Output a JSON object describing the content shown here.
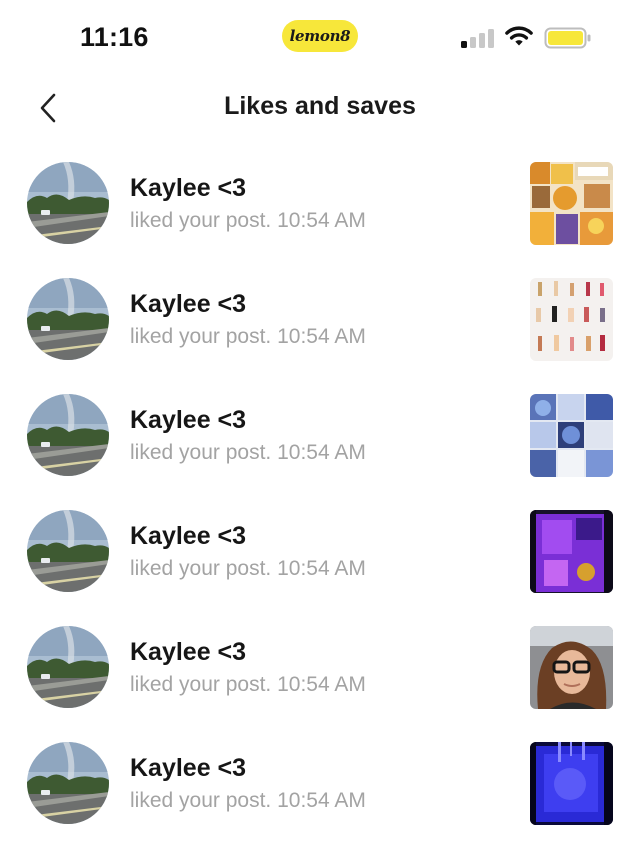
{
  "status_bar": {
    "time": "11:16",
    "app_badge": "lemon8",
    "icons": [
      "cellular-signal-icon",
      "wifi-icon",
      "battery-icon"
    ]
  },
  "header": {
    "back_icon": "chevron-left-icon",
    "title": "Likes and saves"
  },
  "notifications": [
    {
      "user": "Kaylee <3",
      "action": "liked your post.",
      "time": "10:54 AM",
      "thumbnail": "collage-cartoon-stickers"
    },
    {
      "user": "Kaylee <3",
      "action": "liked your post.",
      "time": "10:54 AM",
      "thumbnail": "makeup-products-grid"
    },
    {
      "user": "Kaylee <3",
      "action": "liked your post.",
      "time": "10:54 AM",
      "thumbnail": "stitch-collage"
    },
    {
      "user": "Kaylee <3",
      "action": "liked your post.",
      "time": "10:54 AM",
      "thumbnail": "purple-neon-screen"
    },
    {
      "user": "Kaylee <3",
      "action": "liked your post.",
      "time": "10:54 AM",
      "thumbnail": "selfie-glasses-car"
    },
    {
      "user": "Kaylee <3",
      "action": "liked your post.",
      "time": "10:54 AM",
      "thumbnail": "blue-neon-screen"
    }
  ],
  "colors": {
    "badge_yellow": "#f7e73a",
    "secondary_text": "#a3a3a3",
    "primary_text": "#161616"
  }
}
